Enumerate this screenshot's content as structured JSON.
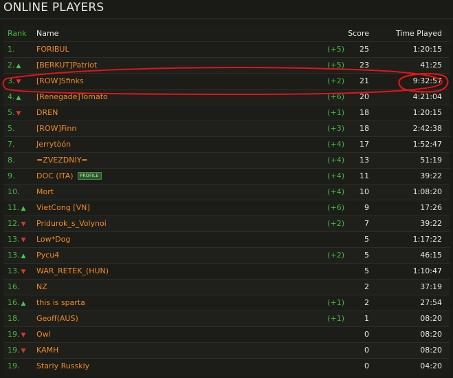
{
  "title": "ONLINE PLAYERS",
  "columns": {
    "rank": "Rank",
    "name": "Name",
    "score": "Score",
    "time": "Time Played"
  },
  "rows": [
    {
      "rank": "1.",
      "trend": "",
      "name": "FORIBUL",
      "delta": "(+5)",
      "score": "25",
      "time": "1:20:15"
    },
    {
      "rank": "2.",
      "trend": "▲",
      "name": "[BERKUT]Patriot",
      "delta": "(+5)",
      "score": "23",
      "time": "41:25"
    },
    {
      "rank": "3.",
      "trend": "▼",
      "name": "[ROW]Sfinks",
      "delta": "(+2)",
      "score": "21",
      "time": "9:32:57"
    },
    {
      "rank": "4.",
      "trend": "▲",
      "name": "[Renegade]Tomato",
      "delta": "(+6)",
      "score": "20",
      "time": "4:21:04"
    },
    {
      "rank": "5.",
      "trend": "▼",
      "name": "DREN",
      "delta": "(+1)",
      "score": "18",
      "time": "1:20:15"
    },
    {
      "rank": "5.",
      "trend": "",
      "name": "[ROW]Finn",
      "delta": "(+3)",
      "score": "18",
      "time": "2:42:38"
    },
    {
      "rank": "7.",
      "trend": "",
      "name": "Jerrytòón",
      "delta": "(+4)",
      "score": "17",
      "time": "1:52:47"
    },
    {
      "rank": "8.",
      "trend": "",
      "name": "=ZVEZDNIY=",
      "delta": "(+4)",
      "score": "13",
      "time": "51:19"
    },
    {
      "rank": "9.",
      "trend": "",
      "name": "DOC (ITA)",
      "badge": "PROFILE",
      "delta": "(+4)",
      "score": "11",
      "time": "39:22"
    },
    {
      "rank": "10.",
      "trend": "",
      "name": "Mort",
      "delta": "(+4)",
      "score": "10",
      "time": "1:08:20"
    },
    {
      "rank": "11.",
      "trend": "▲",
      "name": "VietCong [VN]",
      "delta": "(+6)",
      "score": "9",
      "time": "17:26"
    },
    {
      "rank": "12.",
      "trend": "▼",
      "name": "Pridurok_s_Volynoi",
      "delta": "(+2)",
      "score": "7",
      "time": "39:22"
    },
    {
      "rank": "13.",
      "trend": "▼",
      "name": "Low*Dog",
      "delta": "",
      "score": "5",
      "time": "1:17:22"
    },
    {
      "rank": "13.",
      "trend": "▲",
      "name": "Pycu4",
      "delta": "(+2)",
      "score": "5",
      "time": "46:15"
    },
    {
      "rank": "13.",
      "trend": "▼",
      "name": "WAR_RETEK_(HUN)",
      "delta": "",
      "score": "5",
      "time": "1:10:47"
    },
    {
      "rank": "16.",
      "trend": "",
      "name": "NZ",
      "delta": "",
      "score": "2",
      "time": "37:19"
    },
    {
      "rank": "16.",
      "trend": "▲",
      "name": "this is sparta",
      "delta": "(+1)",
      "score": "2",
      "time": "27:54"
    },
    {
      "rank": "18.",
      "trend": "",
      "name": "Geoff(AUS)",
      "delta": "(+1)",
      "score": "1",
      "time": "08:20"
    },
    {
      "rank": "19.",
      "trend": "▼",
      "name": "Owl",
      "delta": "",
      "score": "0",
      "time": "08:20"
    },
    {
      "rank": "19.",
      "trend": "▼",
      "name": "KAMH",
      "delta": "",
      "score": "0",
      "time": "08:20"
    },
    {
      "rank": "19.",
      "trend": "",
      "name": "Stariy Russkiy",
      "delta": "",
      "score": "0",
      "time": "04:20"
    }
  ],
  "colors": {
    "accent_name": "#f28c1e",
    "rank_green": "#3fbf3a",
    "trend_up": "#4cc34a",
    "trend_down": "#d23a2b",
    "annotation_red": "#e01616"
  }
}
